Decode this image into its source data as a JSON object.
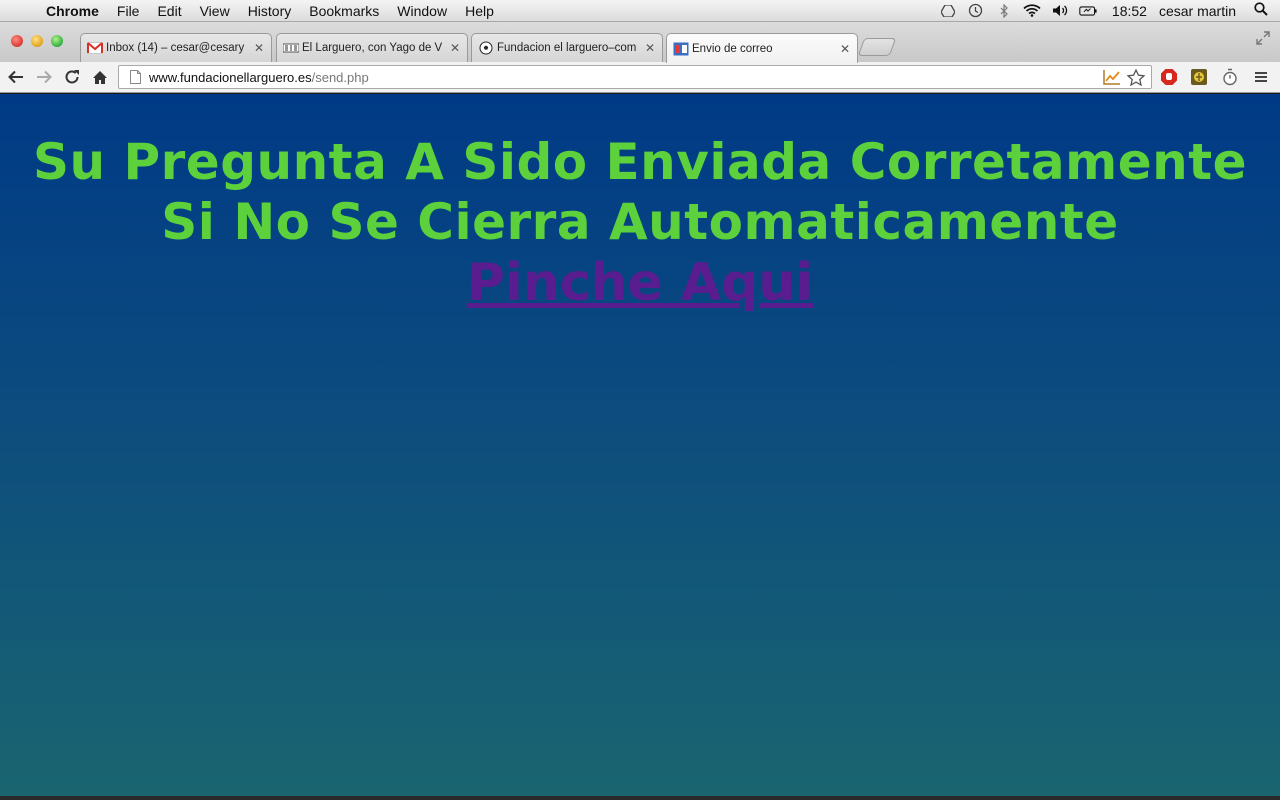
{
  "menubar": {
    "app": "Chrome",
    "items": [
      "File",
      "Edit",
      "View",
      "History",
      "Bookmarks",
      "Window",
      "Help"
    ],
    "clock": "18:52",
    "user": "cesar martin"
  },
  "tabs": [
    {
      "title": "Inbox (14) – cesar@cesary",
      "favicon": "gmail-icon"
    },
    {
      "title": "El Larguero, con Yago de V",
      "favicon": "ser-icon"
    },
    {
      "title": "Fundacion el larguero–com",
      "favicon": "soccer-ball-icon"
    },
    {
      "title": "Envio de correo",
      "favicon": "page-icon"
    }
  ],
  "omnibox": {
    "host": "www.fundacionellarguero.es",
    "path": "/send.php"
  },
  "page": {
    "line1": "Su Pregunta A Sido Enviada Corretamente",
    "line2": "Si No Se Cierra Automaticamente",
    "link": "Pinche Aqui"
  },
  "colors": {
    "heading": "#5cd13c",
    "link": "#5a1d8f",
    "background_top": "#003a86",
    "background_bottom": "#1a6570"
  }
}
